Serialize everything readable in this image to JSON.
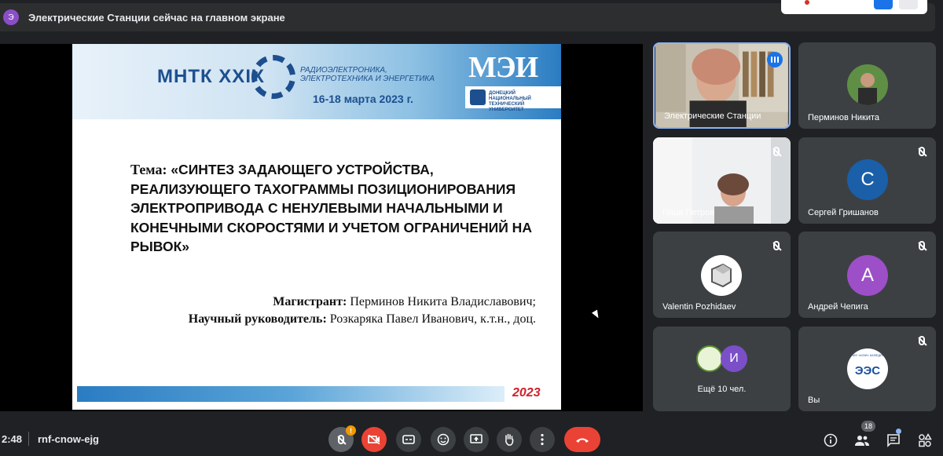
{
  "banner": {
    "avatar_letter": "Э",
    "text": "Электрические Станции сейчас на главном экране"
  },
  "slide": {
    "conf_title": "МНТК XXIX",
    "conf_sub": "РАДИОЭЛЕКТРОНИКА, ЭЛЕКТРОТЕХНИКА И ЭНЕРГЕТИКА",
    "conf_date": "16-18 марта 2023 г.",
    "org_logo": "МЭИ",
    "org_strip": "ДОНЕЦКИЙ НАЦИОНАЛЬНЫЙ ТЕХНИЧЕСКИЙ УНИВЕРСИТЕТ",
    "topic_label": "Тема:",
    "topic_text": "«СИНТЕЗ ЗАДАЮЩЕГО УСТРОЙСТВА, РЕАЛИЗУЮЩЕГО ТАХОГРАММЫ ПОЗИЦИОНИРОВАНИЯ ЭЛЕКТРОПРИВОДА С НЕНУЛЕВЫМИ НАЧАЛЬНЫМИ И КОНЕЧНЫМИ СКОРОСТЯМИ И УЧЕТОМ ОГРАНИЧЕНИЙ НА РЫВОК»",
    "author_label": "Магистрант:",
    "author_name": "Перминов Никита Владиславович;",
    "advisor_label": "Научный руководитель:",
    "advisor_name": "Розкаряка Павел Иванович, к.т.н., доц.",
    "year": "2023"
  },
  "participants": [
    {
      "name": "Электрические Станции",
      "avatar": "",
      "color": "",
      "muted": false,
      "speaking": true
    },
    {
      "name": "Перминов Никита",
      "avatar": "",
      "color": "",
      "muted": false,
      "speaking": false
    },
    {
      "name": "Гоша Петров",
      "avatar": "",
      "color": "",
      "muted": true,
      "speaking": false
    },
    {
      "name": "Сергей Гришанов",
      "avatar": "С",
      "color": "#1a5fa8",
      "muted": true,
      "speaking": false
    },
    {
      "name": "Valentin Pozhidaev",
      "avatar": "",
      "color": "",
      "muted": true,
      "speaking": false
    },
    {
      "name": "Андрей Чепига",
      "avatar": "А",
      "color": "#9c4fc7",
      "muted": true,
      "speaking": false
    },
    {
      "name": "Ещё 10 чел.",
      "avatar": "И",
      "color": "#7b4fc7",
      "muted": false,
      "speaking": false
    },
    {
      "name": "Вы",
      "avatar": "ЭЭС",
      "color": "#ffffff",
      "muted": true,
      "speaking": false
    }
  ],
  "you_logo_caption": "НИУ «МЭИ» КАФЕДРА",
  "bottom": {
    "time": "2:48",
    "meeting_code": "rnf-cnow-ejg",
    "warn": "!",
    "people_count": "18"
  }
}
